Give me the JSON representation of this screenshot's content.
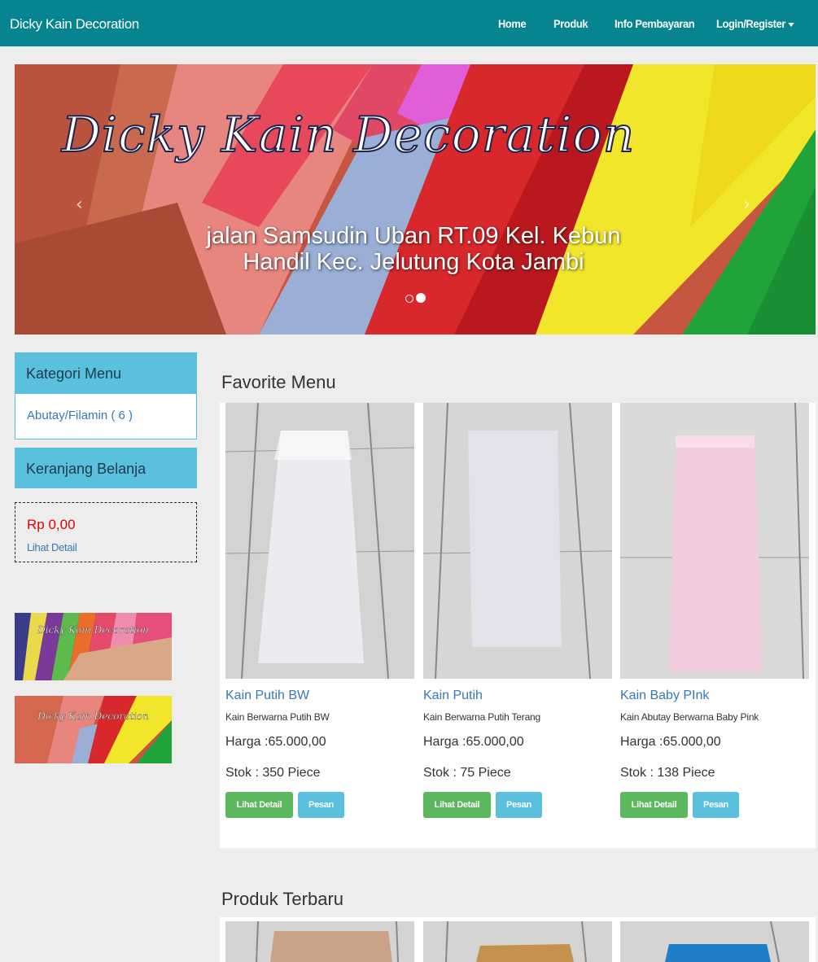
{
  "navbar": {
    "brand": "Dicky Kain Decoration",
    "items": [
      "Home",
      "Produk",
      "Info Pembayaran",
      "Login/Register"
    ]
  },
  "carousel": {
    "title": "Dicky Kain Decoration",
    "address_line1": "jalan Samsudin Uban RT.09 Kel. Kebun",
    "address_line2": "Handil Kec. Jelutung Kota Jambi",
    "prev": "‹",
    "next": "›",
    "slide_count": 2,
    "active_slide": 2
  },
  "sidebar": {
    "category_heading": "Kategori Menu",
    "category_link": "Abutay/Filamin ( 6 )",
    "cart_heading": "Keranjang Belanja",
    "cart_total": "Rp 0,00",
    "cart_detail": "Lihat Detail",
    "banner1_text": "Dicky Kain Decoration",
    "banner2_text": "Dicky Kain Decoration"
  },
  "favorite": {
    "title": "Favorite Menu",
    "products": [
      {
        "name": "Kain Putih BW",
        "desc": "Kain Berwarna Putih BW",
        "price": "Harga :65.000,00",
        "stock": "Stok : 350 Piece",
        "detail_btn": "Lihat Detail",
        "order_btn": "Pesan",
        "color": "#ececf0"
      },
      {
        "name": "Kain Putih",
        "desc": "Kain Berwarna Putih Terang",
        "price": "Harga :65.000,00",
        "stock": "Stok : 75 Piece",
        "detail_btn": "Lihat Detail",
        "order_btn": "Pesan",
        "color": "#e2e2ea"
      },
      {
        "name": "Kain Baby PInk",
        "desc": "Kain Abutay Berwarna Baby Pink",
        "price": "Harga :65.000,00",
        "stock": "Stok : 138 Piece",
        "detail_btn": "Lihat Detail",
        "order_btn": "Pesan",
        "color": "#f2cde0"
      }
    ]
  },
  "latest": {
    "title": "Produk Terbaru",
    "product_colors": [
      "#c9a287",
      "#c4924c",
      "#1e7fc8"
    ]
  },
  "colors": {
    "navbar": "#068490",
    "accent_blue": "#5bc0de",
    "success": "#5cb85c",
    "price_red": "#e00000",
    "link": "#337ab7"
  }
}
